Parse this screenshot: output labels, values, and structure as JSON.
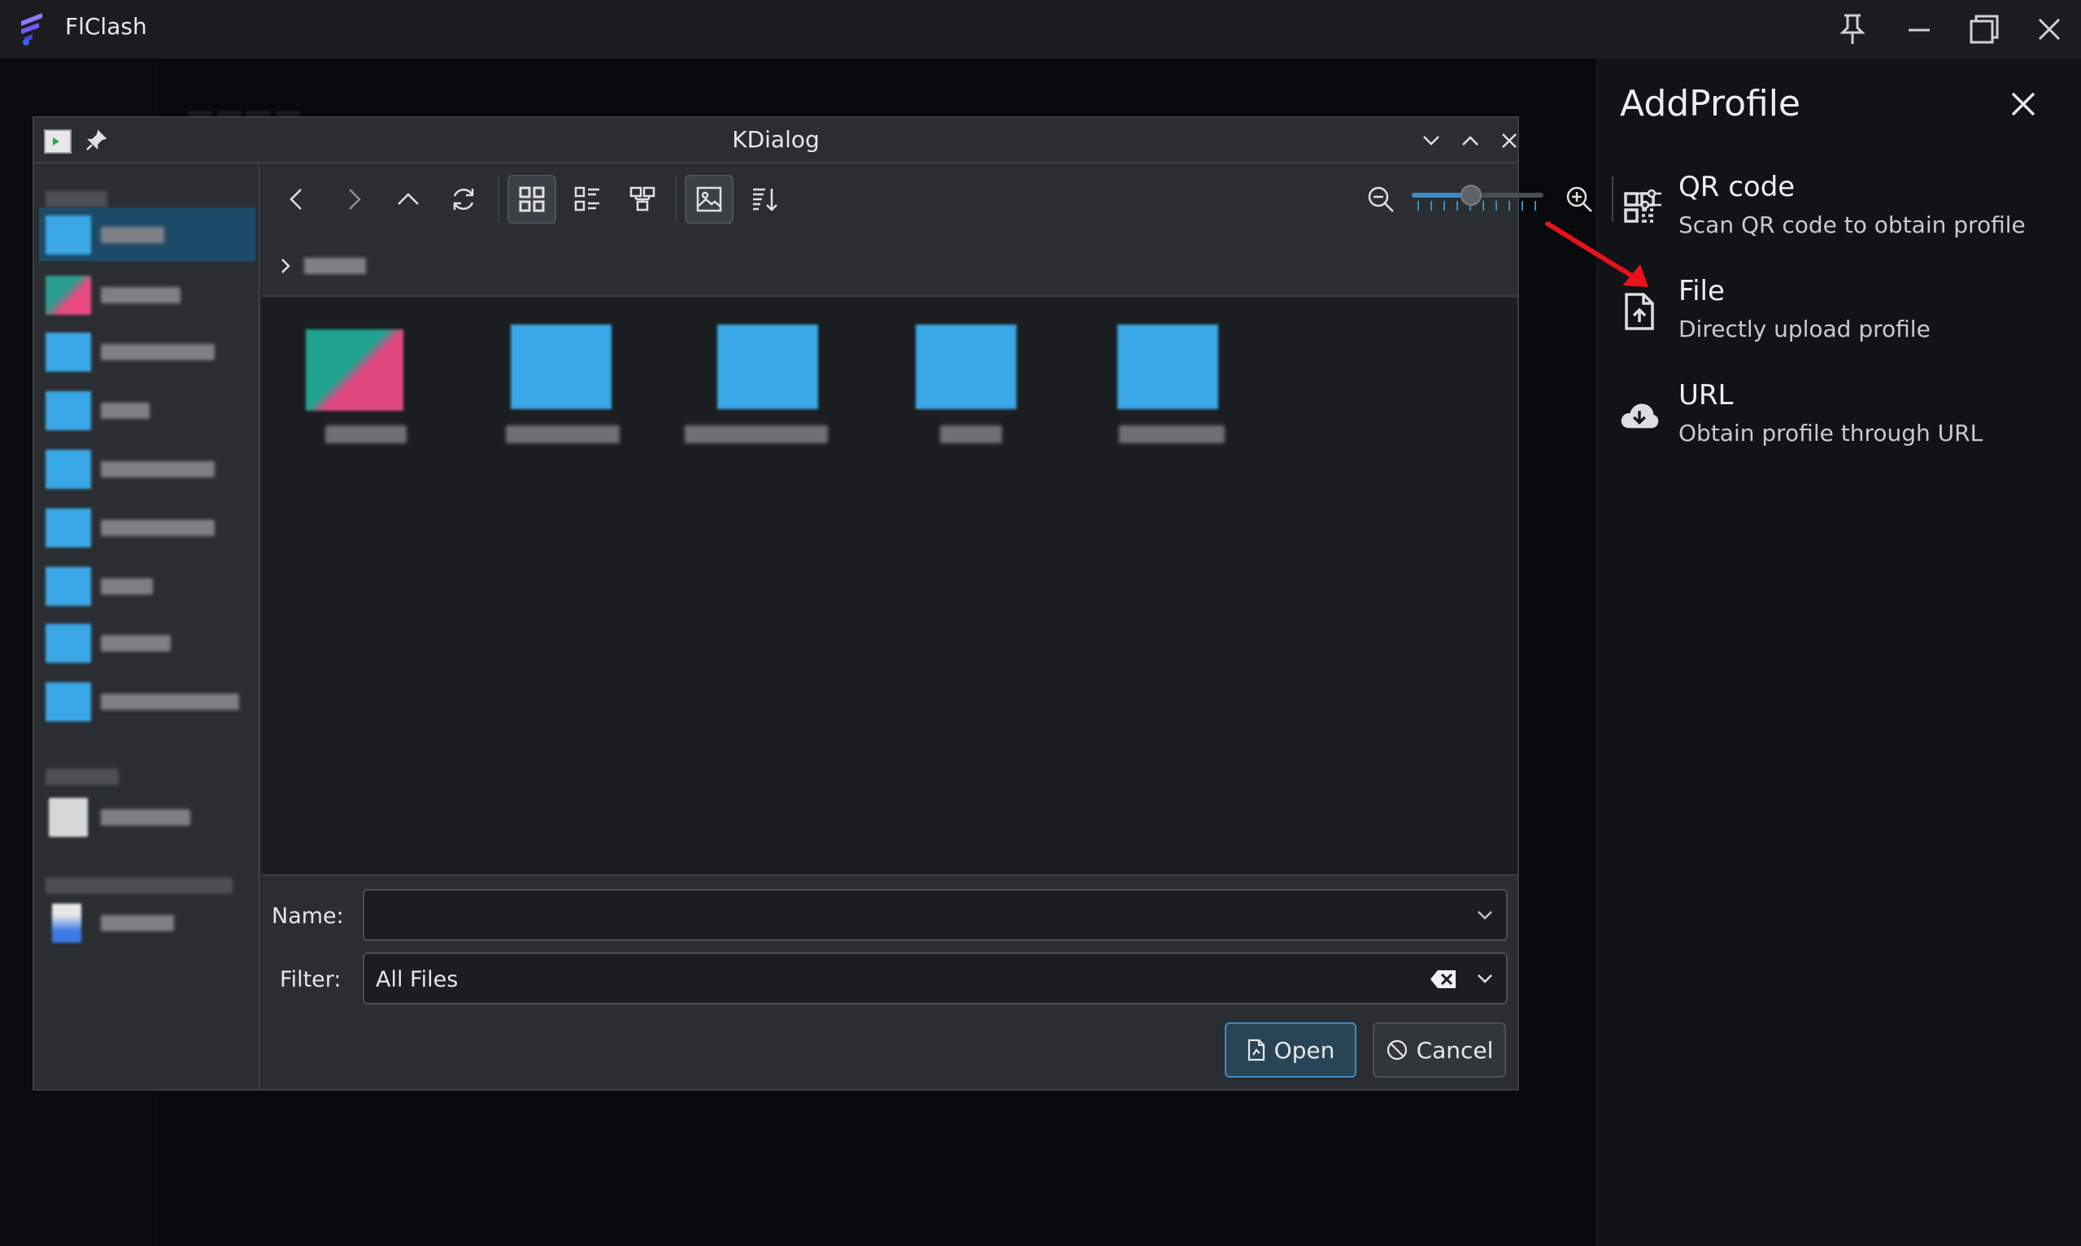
{
  "app": {
    "title": "FlClash",
    "controls": [
      "pin-icon",
      "minimize-icon",
      "maximize-icon",
      "close-icon"
    ]
  },
  "sheet": {
    "title": "AddProfile",
    "options": [
      {
        "icon": "qr-code-icon",
        "title": "QR code",
        "subtitle": "Scan QR code to obtain profile"
      },
      {
        "icon": "file-upload-icon",
        "title": "File",
        "subtitle": "Directly upload profile"
      },
      {
        "icon": "cloud-download-icon",
        "title": "URL",
        "subtitle": "Obtain profile through URL"
      }
    ]
  },
  "dialog": {
    "title": "KDialog",
    "name_label": "Name:",
    "name_value": "",
    "filter_label": "Filter:",
    "filter_value": "All Files",
    "open_label": "Open",
    "cancel_label": "Cancel",
    "zoom_level": 0.45
  },
  "colors": {
    "accent": "#3d8cc4",
    "folder": "#3aa8e6",
    "annotation_arrow": "#e8121b",
    "app_logo": "#6b5cf5"
  }
}
